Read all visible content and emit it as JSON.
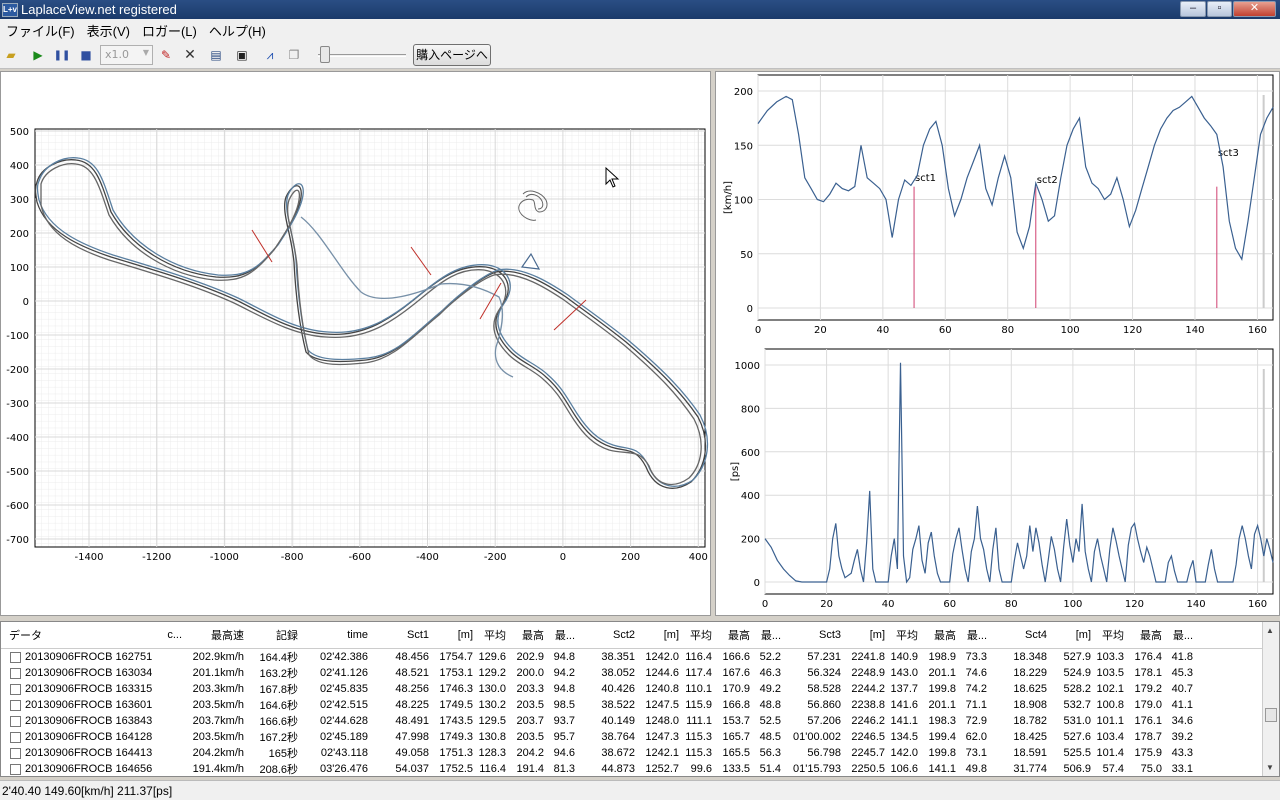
{
  "window": {
    "title": "LaplaceView.net registered",
    "icon_label": "L+v"
  },
  "menu": [
    "ファイル(F)",
    "表示(V)",
    "ロガー(L)",
    "ヘルプ(H)"
  ],
  "toolbar": {
    "speed": "x1.0",
    "buy_label": "購入ページへ"
  },
  "map": {
    "y_ticks": [
      "500",
      "400",
      "300",
      "200",
      "100",
      "0",
      "-100",
      "-200",
      "-300",
      "-400",
      "-500",
      "-600",
      "-700"
    ],
    "x_ticks": [
      "-1400",
      "-1200",
      "-1000",
      "-800",
      "-600",
      "-400",
      "-200",
      "0",
      "200",
      "400"
    ]
  },
  "speed_chart": {
    "ylabel": "[km/h]",
    "y_ticks": [
      "200",
      "150",
      "100",
      "50",
      "0"
    ],
    "x_ticks": [
      "0",
      "20",
      "40",
      "60",
      "80",
      "100",
      "120",
      "140",
      "160"
    ],
    "markers": [
      {
        "label": "sct1",
        "x": 50
      },
      {
        "label": "sct2",
        "x": 89
      },
      {
        "label": "sct3",
        "x": 147
      }
    ]
  },
  "ps_chart": {
    "ylabel": "[ps]",
    "y_ticks": [
      "1000",
      "800",
      "600",
      "400",
      "200",
      "0"
    ],
    "x_ticks": [
      "0",
      "20",
      "40",
      "60",
      "80",
      "100",
      "120",
      "140",
      "160"
    ]
  },
  "table": {
    "columns": [
      "データ",
      "c...",
      "最高速",
      "記録",
      "time",
      "Sct1",
      "[m]",
      "平均",
      "最高",
      "最...",
      "Sct2",
      "[m]",
      "平均",
      "最高",
      "最...",
      "Sct3",
      "[m]",
      "平均",
      "最高",
      "最...",
      "Sct4",
      "[m]",
      "平均",
      "最高",
      "最..."
    ],
    "rows": [
      [
        "20130906FROCB 162751",
        "",
        "202.9km/h",
        "164.4秒",
        "02'42.386",
        "48.456",
        "1754.7",
        "129.6",
        "202.9",
        "94.8",
        "38.351",
        "1242.0",
        "116.4",
        "166.6",
        "52.2",
        "57.231",
        "2241.8",
        "140.9",
        "198.9",
        "73.3",
        "18.348",
        "527.9",
        "103.3",
        "176.4",
        "41.8"
      ],
      [
        "20130906FROCB 163034",
        "",
        "201.1km/h",
        "163.2秒",
        "02'41.126",
        "48.521",
        "1753.1",
        "129.2",
        "200.0",
        "94.2",
        "38.052",
        "1244.6",
        "117.4",
        "167.6",
        "46.3",
        "56.324",
        "2248.9",
        "143.0",
        "201.1",
        "74.6",
        "18.229",
        "524.9",
        "103.5",
        "178.1",
        "45.3"
      ],
      [
        "20130906FROCB 163315",
        "",
        "203.3km/h",
        "167.8秒",
        "02'45.835",
        "48.256",
        "1746.3",
        "130.0",
        "203.3",
        "94.8",
        "40.426",
        "1240.8",
        "110.1",
        "170.9",
        "49.2",
        "58.528",
        "2244.2",
        "137.7",
        "199.8",
        "74.2",
        "18.625",
        "528.2",
        "102.1",
        "179.2",
        "40.7"
      ],
      [
        "20130906FROCB 163601",
        "",
        "203.5km/h",
        "164.6秒",
        "02'42.515",
        "48.225",
        "1749.5",
        "130.2",
        "203.5",
        "98.5",
        "38.522",
        "1247.5",
        "115.9",
        "166.8",
        "48.8",
        "56.860",
        "2238.8",
        "141.6",
        "201.1",
        "71.1",
        "18.908",
        "532.7",
        "100.8",
        "179.0",
        "41.1"
      ],
      [
        "20130906FROCB 163843",
        "",
        "203.7km/h",
        "166.6秒",
        "02'44.628",
        "48.491",
        "1743.5",
        "129.5",
        "203.7",
        "93.7",
        "40.149",
        "1248.0",
        "111.1",
        "153.7",
        "52.5",
        "57.206",
        "2246.2",
        "141.1",
        "198.3",
        "72.9",
        "18.782",
        "531.0",
        "101.1",
        "176.1",
        "34.6"
      ],
      [
        "20130906FROCB 164128",
        "",
        "203.5km/h",
        "167.2秒",
        "02'45.189",
        "47.998",
        "1749.3",
        "130.8",
        "203.5",
        "95.7",
        "38.764",
        "1247.3",
        "115.3",
        "165.7",
        "48.5",
        "01'00.002",
        "2246.5",
        "134.5",
        "199.4",
        "62.0",
        "18.425",
        "527.6",
        "103.4",
        "178.7",
        "39.2"
      ],
      [
        "20130906FROCB 164413",
        "",
        "204.2km/h",
        "165秒",
        "02'43.118",
        "49.058",
        "1751.3",
        "128.3",
        "204.2",
        "94.6",
        "38.672",
        "1242.1",
        "115.3",
        "165.5",
        "56.3",
        "56.798",
        "2245.7",
        "142.0",
        "199.8",
        "73.1",
        "18.591",
        "525.5",
        "101.4",
        "175.9",
        "43.3"
      ],
      [
        "20130906FROCB 164656",
        "",
        "191.4km/h",
        "208.6秒",
        "03'26.476",
        "54.037",
        "1752.5",
        "116.4",
        "191.4",
        "81.3",
        "44.873",
        "1252.7",
        "99.6",
        "133.5",
        "51.4",
        "01'15.793",
        "2250.5",
        "106.6",
        "141.1",
        "49.8",
        "31.774",
        "506.9",
        "57.4",
        "75.0",
        "33.1"
      ]
    ]
  },
  "status": "2'40.40 149.60[km/h] 211.37[ps]"
}
